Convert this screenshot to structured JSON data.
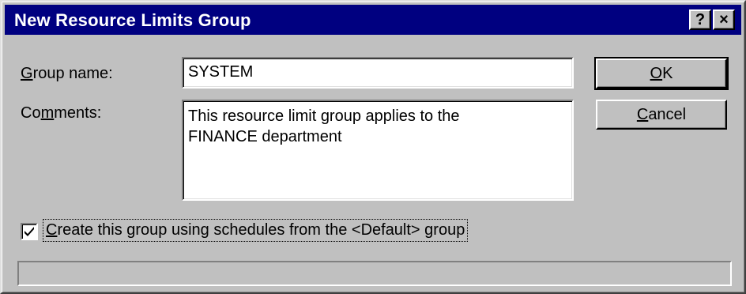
{
  "window": {
    "title": "New Resource Limits Group",
    "help_button": "?",
    "close_button": "×"
  },
  "form": {
    "group_name": {
      "label_accel": "G",
      "label_rest": "roup name:",
      "value": "SYSTEM"
    },
    "comments": {
      "label_pre": "Co",
      "label_accel": "m",
      "label_rest": "ments:",
      "value_line1": "This resource limit group applies to the",
      "value_line2": "FINANCE department"
    },
    "checkbox": {
      "checked": true,
      "label_accel": "C",
      "label_rest": "reate this group using schedules from the <Default> group"
    }
  },
  "buttons": {
    "ok": {
      "accel": "O",
      "rest": "K"
    },
    "cancel": {
      "accel": "C",
      "rest": "ancel"
    }
  },
  "status_bar": {
    "text": ""
  }
}
